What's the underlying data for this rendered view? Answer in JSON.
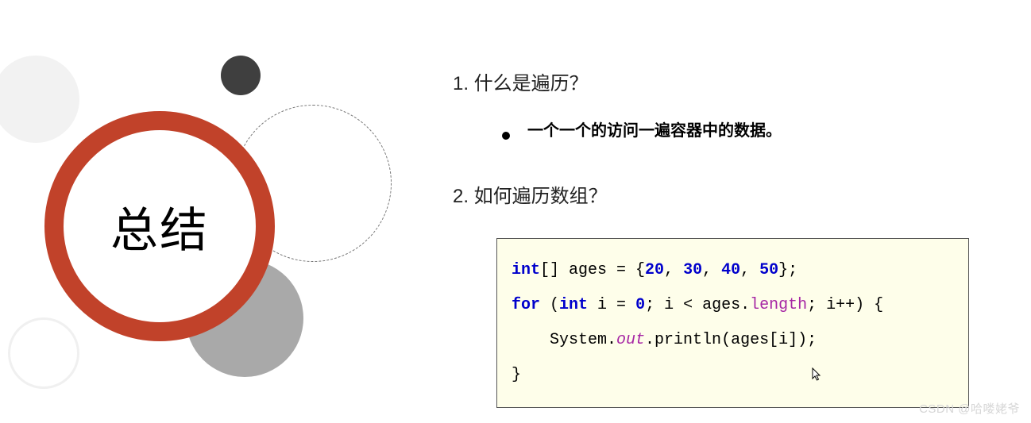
{
  "title_circle": "总结",
  "q1": {
    "heading": "1. 什么是遍历？",
    "bullet": "一个一个的访问一遍容器中的数据。"
  },
  "q2": {
    "heading": "2. 如何遍历数组？"
  },
  "code": {
    "line1": {
      "kw1": "int",
      "mid": "[] ages = {",
      "n1": "20",
      "c1": ", ",
      "n2": "30",
      "c2": ", ",
      "n3": "40",
      "c3": ", ",
      "n4": "50",
      "end": "};"
    },
    "line2": {
      "kw1": "for ",
      "p1": "(",
      "kw2": "int",
      "mid": " i = ",
      "n1": "0",
      "mid2": "; i < ages.",
      "fld": "length",
      "end": "; i++) {"
    },
    "line3": {
      "indent": "    System.",
      "out": "out",
      "rest": ".println(ages[i]);"
    },
    "line4": "}"
  },
  "watermark": "CSDN @哈喽姥爷"
}
